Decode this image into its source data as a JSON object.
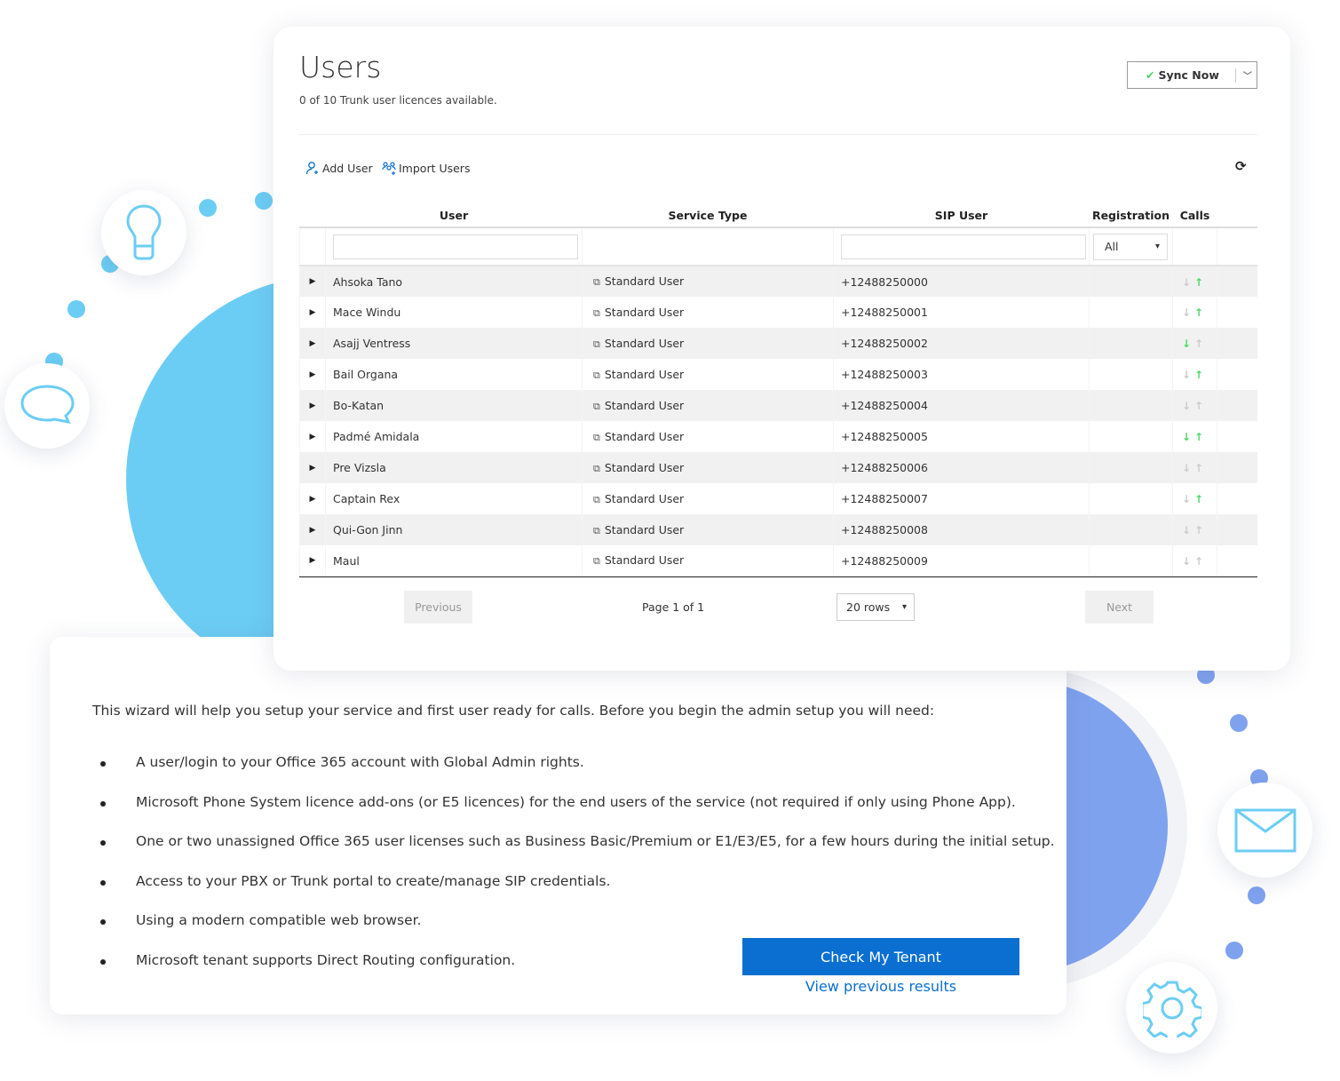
{
  "colors": {
    "accent_blue": "#0a6fd1",
    "sky": "#6ccdf4",
    "periwinkle": "#7fa2ee",
    "green": "#4cd964"
  },
  "decor_icons": [
    "lightbulb-icon",
    "speech-bubble-icon",
    "envelope-icon",
    "gear-icon"
  ],
  "users_panel": {
    "title": "Users",
    "subtitle": "0 of 10 Trunk user licences available.",
    "sync_label": "Sync Now",
    "add_user": "Add User",
    "import_users": "Import Users",
    "columns": [
      "User",
      "Service Type",
      "SIP User",
      "Registration",
      "Calls"
    ],
    "registration_filter": "All",
    "rows": [
      {
        "user": "Ahsoka Tano",
        "service": "Standard User",
        "sip": "+12488250000",
        "in": false,
        "out": true
      },
      {
        "user": "Mace Windu",
        "service": "Standard User",
        "sip": "+12488250001",
        "in": false,
        "out": true
      },
      {
        "user": "Asajj Ventress",
        "service": "Standard User",
        "sip": "+12488250002",
        "in": true,
        "out": false
      },
      {
        "user": "Bail Organa",
        "service": "Standard User",
        "sip": "+12488250003",
        "in": false,
        "out": true
      },
      {
        "user": "Bo-Katan",
        "service": "Standard User",
        "sip": "+12488250004",
        "in": false,
        "out": false
      },
      {
        "user": "Padmé Amidala",
        "service": "Standard User",
        "sip": "+12488250005",
        "in": true,
        "out": true
      },
      {
        "user": "Pre Vizsla",
        "service": "Standard User",
        "sip": "+12488250006",
        "in": false,
        "out": false
      },
      {
        "user": "Captain Rex",
        "service": "Standard User",
        "sip": "+12488250007",
        "in": false,
        "out": true
      },
      {
        "user": "Qui-Gon Jinn",
        "service": "Standard User",
        "sip": "+12488250008",
        "in": false,
        "out": false
      },
      {
        "user": "Maul",
        "service": "Standard User",
        "sip": "+12488250009",
        "in": false,
        "out": false
      }
    ],
    "pagination": {
      "previous": "Previous",
      "page_text": "Page 1 of 1",
      "rows_select": "20 rows",
      "next": "Next"
    }
  },
  "wizard": {
    "intro": "This wizard will help you setup your service and first user ready for calls. Before you begin the admin setup you will need:",
    "requirements": [
      "A user/login to your Office 365 account with Global Admin rights.",
      "Microsoft Phone System licence add-ons (or E5 licences) for the end users of the service (not required if only using Phone App).",
      "One or two unassigned Office 365 user licenses such as Business Basic/Premium or E1/E3/E5, for a few hours during the initial setup.",
      "Access to your PBX or Trunk portal to create/manage SIP credentials.",
      "Using a modern compatible web browser.",
      "Microsoft tenant supports Direct Routing configuration."
    ],
    "check_button": "Check My Tenant",
    "previous_results": "View previous results"
  }
}
